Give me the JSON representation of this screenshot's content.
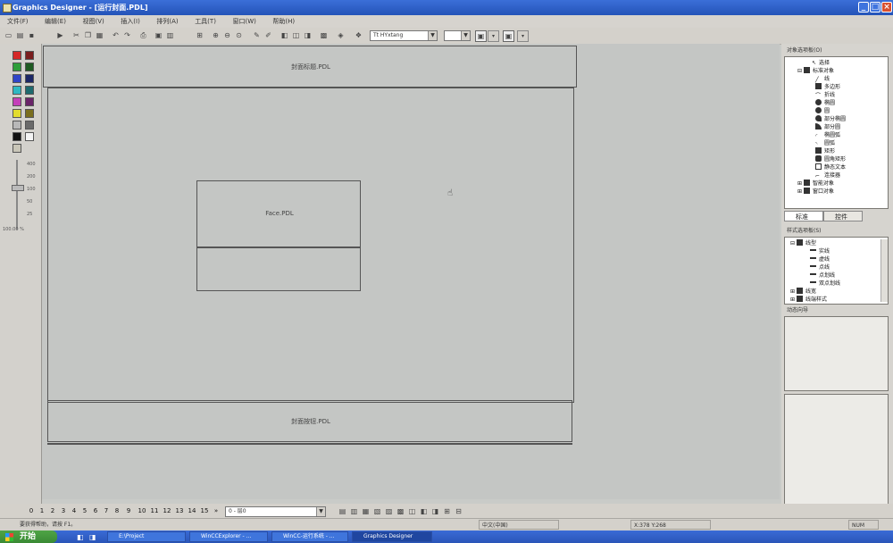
{
  "window": {
    "title": "Graphics Designer - [运行封面.PDL]"
  },
  "menu": [
    "文件(F)",
    "编辑(E)",
    "视图(V)",
    "插入(I)",
    "排列(A)",
    "工具(T)",
    "窗口(W)",
    "帮助(H)"
  ],
  "toolbar": {
    "font": "Tt HYxtang",
    "size": ""
  },
  "left_panel": {
    "zoom_levels": [
      "400",
      "200",
      "100",
      "50",
      "25"
    ],
    "zoom_value": "100.00 %"
  },
  "canvas": {
    "header_pic": "封面标题.PDL",
    "face_pic": "Face.PDL",
    "button_pic": "封面按钮.PDL"
  },
  "object_palette": {
    "title": "对象选项板(O)",
    "items": [
      "选择",
      "标准对象",
      "线",
      "多边形",
      "折线",
      "椭圆",
      "圆",
      "部分椭圆",
      "部分圆",
      "椭圆弧",
      "圆弧",
      "矩形",
      "圆角矩形",
      "静态文本",
      "连接器",
      "智能对象",
      "窗口对象"
    ],
    "tabs": [
      "标准",
      "控件"
    ]
  },
  "style_palette": {
    "title": "样式选项板(S)",
    "items": [
      "线型",
      "实线",
      "虚线",
      "点线",
      "点划线",
      "双点划线",
      "线宽",
      "线端样式"
    ]
  },
  "dynamic_wizard": {
    "title": "动态向导"
  },
  "page_bar": {
    "pages": [
      "0",
      "1",
      "2",
      "3",
      "4",
      "5",
      "6",
      "7",
      "8",
      "9",
      "10",
      "11",
      "12",
      "13",
      "14",
      "15"
    ],
    "more": "»",
    "layer": "0 - 层0"
  },
  "status": {
    "help": "要获得帮助，请按 F1。",
    "language": "中文(中国)",
    "coords": "X:378 Y:268",
    "caps": "NUM"
  },
  "taskbar": {
    "start": "开始",
    "tasks": [
      "E:\\Project",
      "WinCCExplorer - ...",
      "WinCC-运行系统 - ...",
      "Graphics Designer"
    ]
  }
}
